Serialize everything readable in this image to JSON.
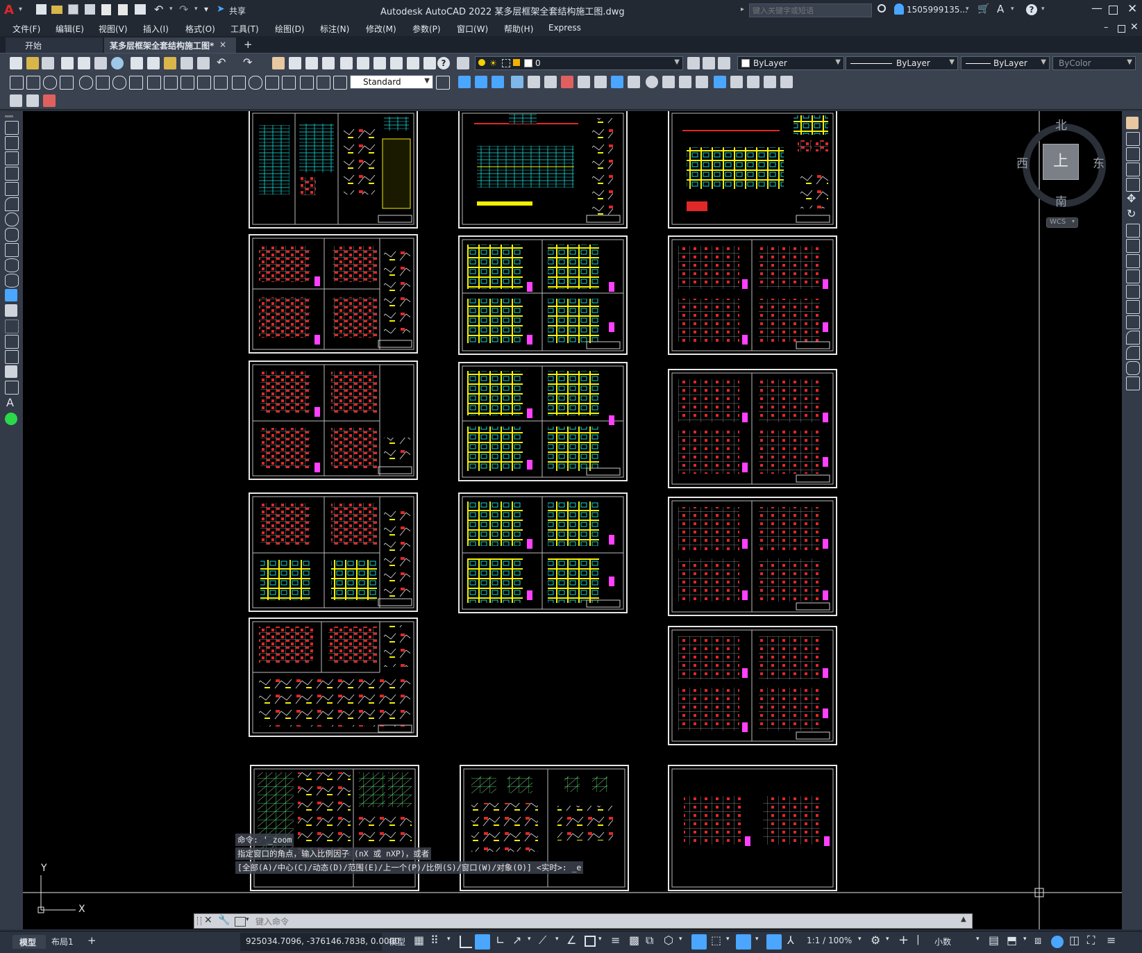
{
  "app": {
    "window_title": "Autodesk AutoCAD 2022    某多层框架全套结构施工图.dwg",
    "share": "共享",
    "search_placeholder": "键入关键字或短语",
    "user": "1505999135...",
    "help": "?"
  },
  "menu": [
    "文件(F)",
    "编辑(E)",
    "视图(V)",
    "插入(I)",
    "格式(O)",
    "工具(T)",
    "绘图(D)",
    "标注(N)",
    "修改(M)",
    "参数(P)",
    "窗口(W)",
    "帮助(H)",
    "Express"
  ],
  "tabs": {
    "start": "开始",
    "active": "某多层框架全套结构施工图*",
    "close": "×",
    "add": "+"
  },
  "toolbar": {
    "layer": "0",
    "textstyle": "Standard",
    "color": "ByLayer",
    "linetype": "ByLayer",
    "lineweight": "ByLayer",
    "plotstyle": "ByColor"
  },
  "viewcube": {
    "north": "北",
    "south": "南",
    "east": "东",
    "west": "西",
    "top": "上",
    "wcs": "WCS"
  },
  "ucs": {
    "x": "X",
    "y": "Y"
  },
  "command": {
    "line1": "命令: '_zoom",
    "line2": "指定窗口的角点，输入比例因子 (nX 或 nXP)，或者",
    "line3": "[全部(A)/中心(C)/动态(D)/范围(E)/上一个(P)/比例(S)/窗口(W)/对象(O)] <实时>: _e",
    "placeholder": "键入命令"
  },
  "status": {
    "model_tab": "模型",
    "layout_tab": "布局1",
    "add": "+",
    "coords": "925034.7096, -376146.7838, 0.0000",
    "space": "模型",
    "scale": "1:1 / 100%",
    "units": "小数"
  },
  "colors": {
    "canvas": "#000000",
    "sheet_border": "#e8e8e8",
    "red": "#e02828",
    "yellow": "#f5f000",
    "cyan": "#19d6d6",
    "green": "#2bd84a",
    "magenta": "#ff40ff"
  }
}
